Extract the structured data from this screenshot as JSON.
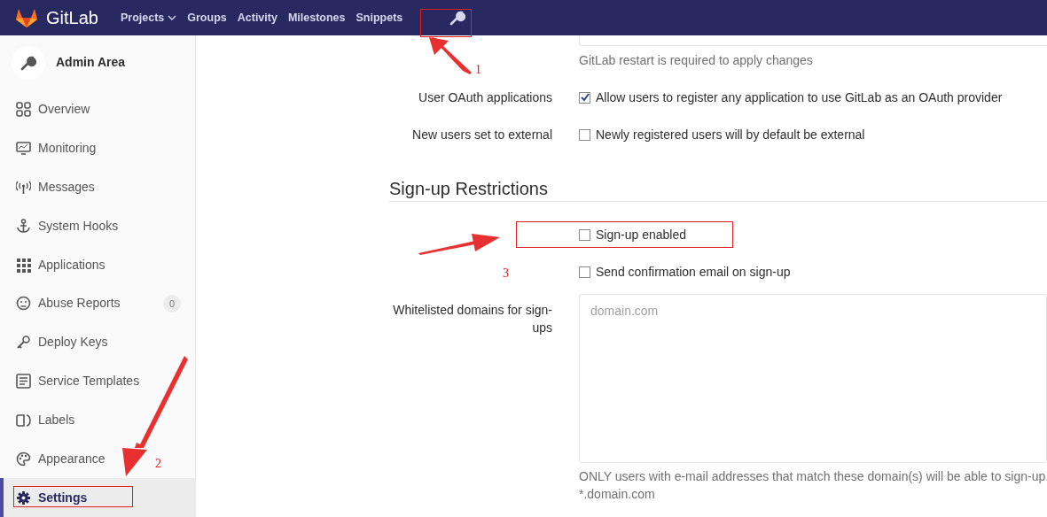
{
  "navbar": {
    "brand": "GitLab",
    "items": [
      {
        "label": "Projects",
        "dropdown": true
      },
      {
        "label": "Groups",
        "dropdown": false
      },
      {
        "label": "Activity",
        "dropdown": false
      },
      {
        "label": "Milestones",
        "dropdown": false
      },
      {
        "label": "Snippets",
        "dropdown": false
      }
    ]
  },
  "sidebar": {
    "title": "Admin Area",
    "items": [
      {
        "label": "Overview",
        "selected": false
      },
      {
        "label": "Monitoring",
        "selected": false
      },
      {
        "label": "Messages",
        "selected": false
      },
      {
        "label": "System Hooks",
        "selected": false
      },
      {
        "label": "Applications",
        "selected": false
      },
      {
        "label": "Abuse Reports",
        "selected": false,
        "badge": "0"
      },
      {
        "label": "Deploy Keys",
        "selected": false
      },
      {
        "label": "Service Templates",
        "selected": false
      },
      {
        "label": "Labels",
        "selected": false
      },
      {
        "label": "Appearance",
        "selected": false
      },
      {
        "label": "Settings",
        "selected": true
      }
    ]
  },
  "session_hint": "GitLab restart is required to apply changes",
  "options": [
    {
      "label": "User OAuth applications",
      "text": "Allow users to register any application to use GitLab as an OAuth provider",
      "checked": true
    },
    {
      "label": "New users set to external",
      "text": "Newly registered users will by default be external",
      "checked": false
    }
  ],
  "section": {
    "title": "Sign-up Restrictions",
    "options": [
      {
        "text": "Sign-up enabled",
        "checked": false
      },
      {
        "text": "Send confirmation email on sign-up",
        "checked": false
      }
    ],
    "whitelist": {
      "label": "Whitelisted domains for sign-ups",
      "placeholder": "domain.com",
      "help": [
        "ONLY users with e-mail addresses that match these domain(s) will be able to sign-up.",
        "*.domain.com"
      ]
    }
  },
  "annotations": [
    {
      "label": "1"
    },
    {
      "label": "2"
    },
    {
      "label": "3"
    }
  ]
}
